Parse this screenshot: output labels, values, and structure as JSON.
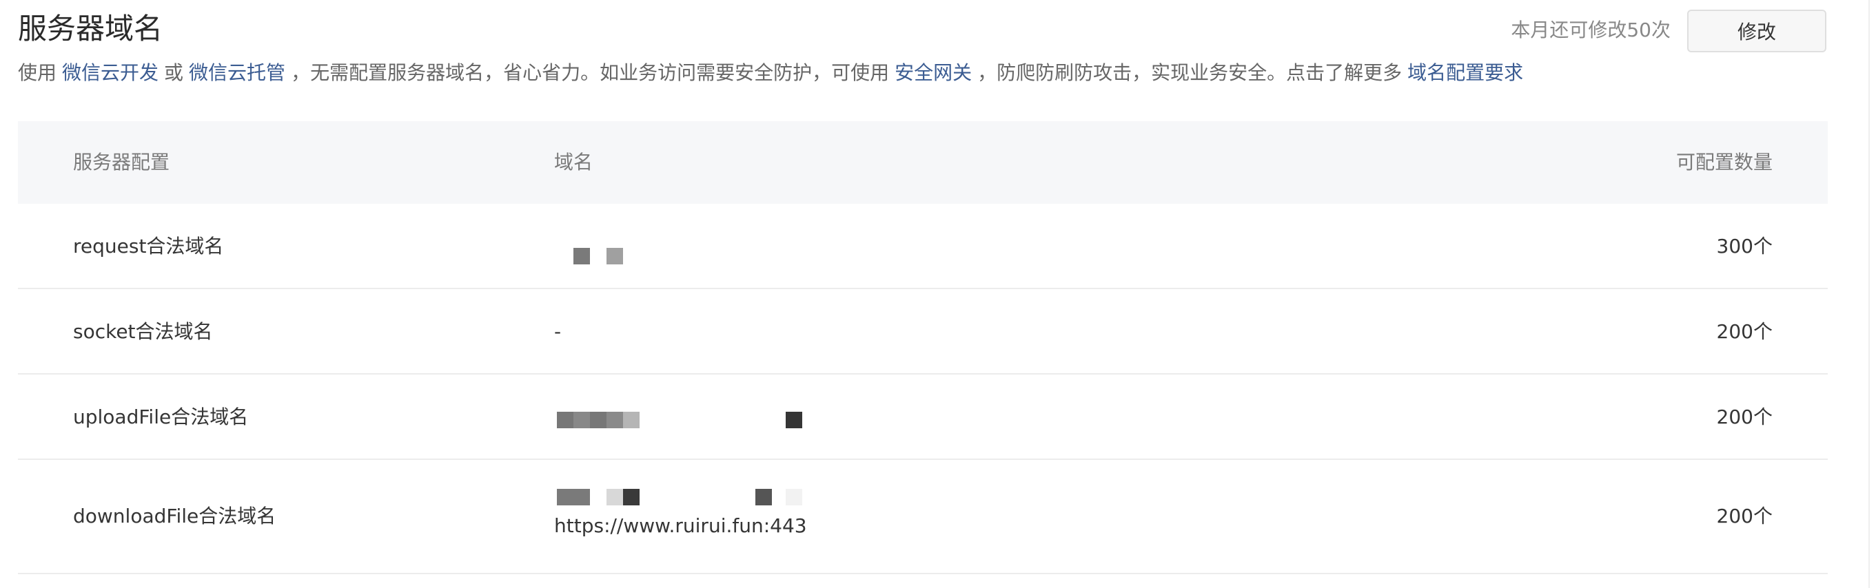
{
  "header": {
    "title": "服务器域名",
    "quota": "本月还可修改50次",
    "edit_label": "修改"
  },
  "description": {
    "t1": "使用",
    "link1": "微信云开发",
    "t2": "或",
    "link2": "微信云托管",
    "t3": "，无需配置服务器域名，省心省力。如业务访问需要安全防护，可使用",
    "link3": "安全网关",
    "t4": "，防爬防刷防攻击，实现业务安全。点击了解更多",
    "link4": "域名配置要求"
  },
  "table": {
    "columns": [
      "服务器配置",
      "域名",
      "可配置数量"
    ],
    "rows": [
      {
        "name": "request合法域名",
        "domain": "",
        "count": "300个"
      },
      {
        "name": "socket合法域名",
        "domain": "-",
        "count": "200个"
      },
      {
        "name": "uploadFile合法域名",
        "domain": "",
        "count": "200个"
      },
      {
        "name": "downloadFile合法域名",
        "domain": "https://www.ruirui.fun:443",
        "count": "200个"
      }
    ]
  },
  "colors": {
    "link": "#3b5c92",
    "header_bg": "#f6f7f9"
  }
}
